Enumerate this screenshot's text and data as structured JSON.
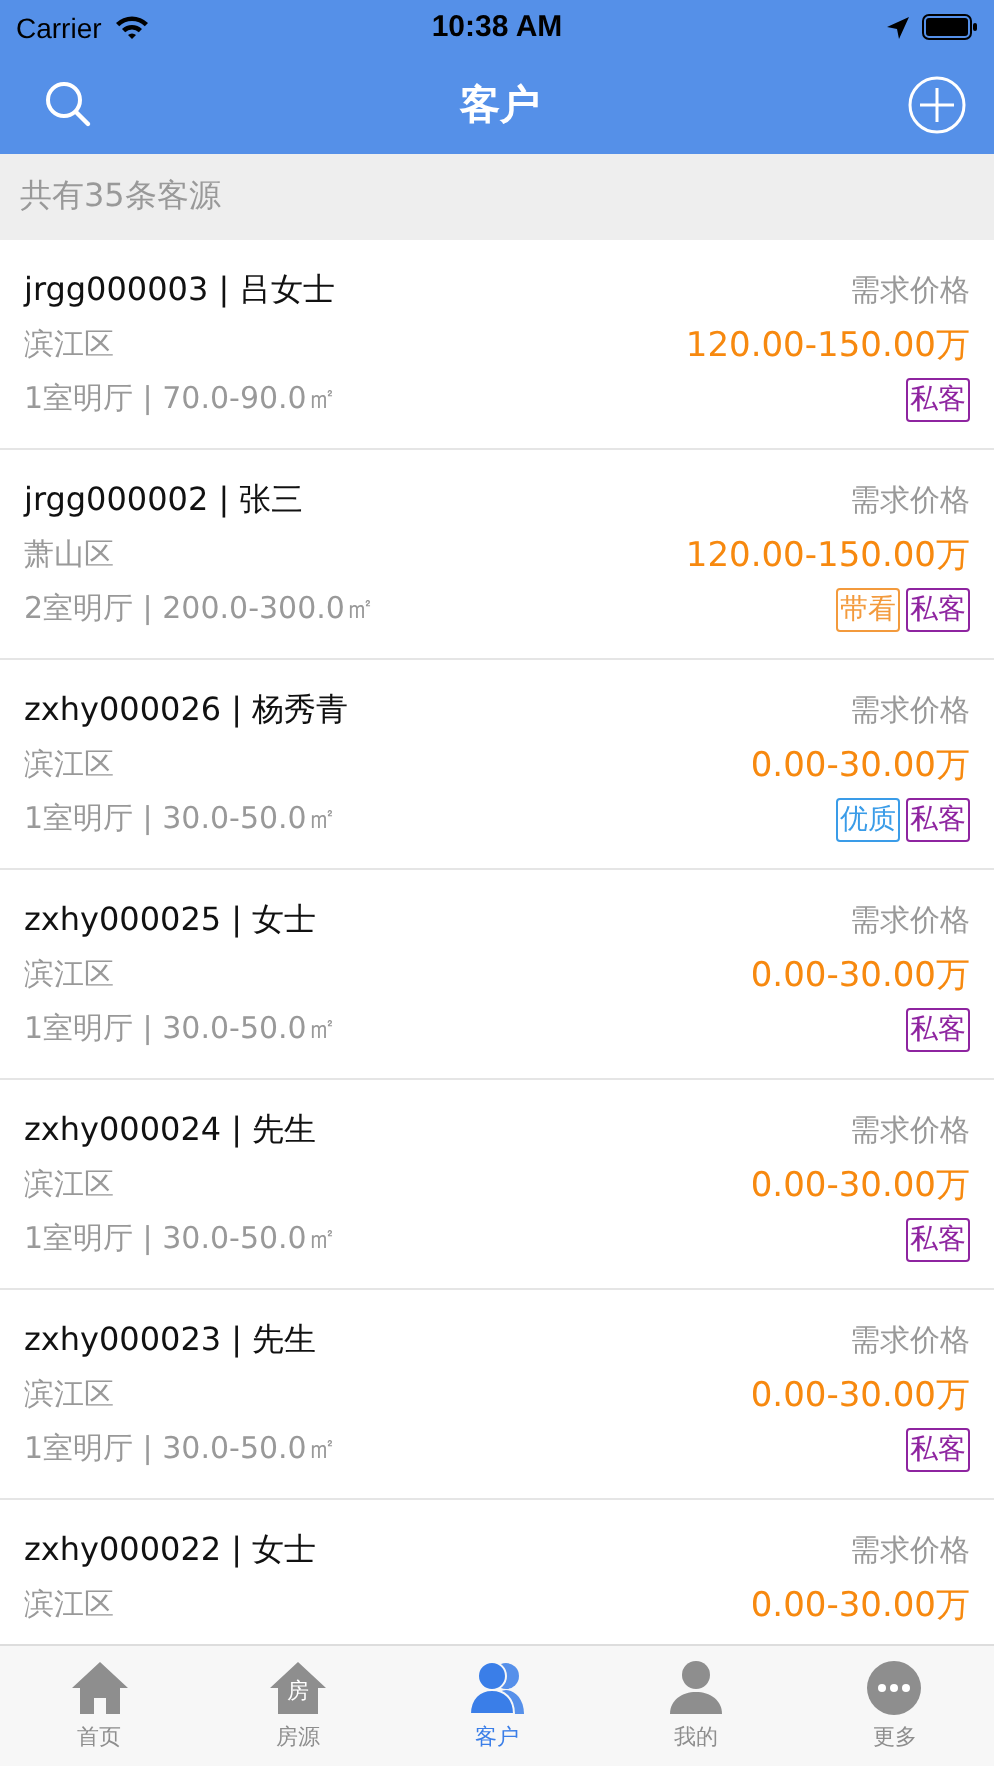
{
  "status_bar": {
    "carrier": "Carrier",
    "time": "10:38 AM"
  },
  "nav": {
    "title": "客户"
  },
  "summary": "共有35条客源",
  "customers": [
    {
      "name": "jrgg000003 | 吕女士",
      "price_label": "需求价格",
      "area": "滨江区",
      "price": "120.00-150.00万",
      "spec": "1室明厅 | 70.0-90.0㎡",
      "tags": [
        {
          "label": "私客",
          "color": "#8e24a0"
        }
      ]
    },
    {
      "name": "jrgg000002 | 张三",
      "price_label": "需求价格",
      "area": "萧山区",
      "price": "120.00-150.00万",
      "spec": "2室明厅 | 200.0-300.0㎡",
      "tags": [
        {
          "label": "带看",
          "color": "#f39a3c"
        },
        {
          "label": "私客",
          "color": "#8e24a0"
        }
      ]
    },
    {
      "name": "zxhy000026 | 杨秀青",
      "price_label": "需求价格",
      "area": "滨江区",
      "price": "0.00-30.00万",
      "spec": "1室明厅 | 30.0-50.0㎡",
      "tags": [
        {
          "label": "优质",
          "color": "#3a9ce8"
        },
        {
          "label": "私客",
          "color": "#8e24a0"
        }
      ]
    },
    {
      "name": "zxhy000025 | 女士",
      "price_label": "需求价格",
      "area": "滨江区",
      "price": "0.00-30.00万",
      "spec": "1室明厅 | 30.0-50.0㎡",
      "tags": [
        {
          "label": "私客",
          "color": "#8e24a0"
        }
      ]
    },
    {
      "name": "zxhy000024 | 先生",
      "price_label": "需求价格",
      "area": "滨江区",
      "price": "0.00-30.00万",
      "spec": "1室明厅 | 30.0-50.0㎡",
      "tags": [
        {
          "label": "私客",
          "color": "#8e24a0"
        }
      ]
    },
    {
      "name": "zxhy000023 | 先生",
      "price_label": "需求价格",
      "area": "滨江区",
      "price": "0.00-30.00万",
      "spec": "1室明厅 | 30.0-50.0㎡",
      "tags": [
        {
          "label": "私客",
          "color": "#8e24a0"
        }
      ]
    },
    {
      "name": "zxhy000022 | 女士",
      "price_label": "需求价格",
      "area": "滨江区",
      "price": "0.00-30.00万"
    }
  ],
  "tabs": [
    {
      "kind": "home",
      "label": "首页",
      "selected": false
    },
    {
      "kind": "house",
      "label": "房源",
      "icon_text": "房",
      "selected": false
    },
    {
      "kind": "people",
      "label": "客户",
      "selected": true
    },
    {
      "kind": "person",
      "label": "我的",
      "selected": false
    },
    {
      "kind": "more",
      "label": "更多",
      "selected": false
    }
  ]
}
